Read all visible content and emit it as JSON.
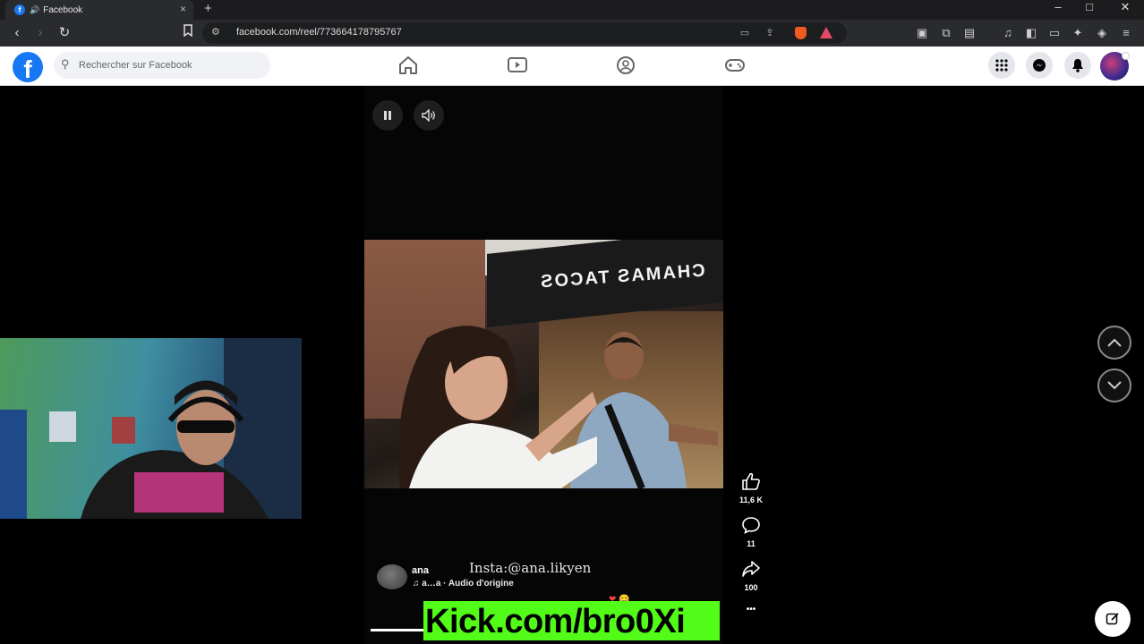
{
  "browser": {
    "tab": {
      "title": "Facebook",
      "close": "×"
    },
    "new_tab": "+",
    "window_controls": {
      "minimize": "–",
      "maximize": "□",
      "close": "✕"
    },
    "url": "facebook.com/reel/773664178795767"
  },
  "facebook": {
    "logo": "f",
    "search": {
      "placeholder": "Rechercher sur Facebook"
    },
    "nav_icons": [
      "home-icon",
      "watch-icon",
      "groups-icon",
      "gaming-icon"
    ],
    "right_icons": [
      "menu-grid-icon",
      "messenger-icon",
      "notifications-icon"
    ]
  },
  "video": {
    "sign_text": "CHAMAS TACOS",
    "overlay_text": "Insta:@ana.likyen"
  },
  "actions": {
    "likes": "11,6 K",
    "comments": "11",
    "shares": "100",
    "more": "•••"
  },
  "caption": {
    "author": "ana",
    "audio": "a…a · Audio d'origine"
  },
  "stream": {
    "banner_text": "Kick.com/bro0Xi",
    "banner_color": "#53fc18"
  },
  "colors": {
    "facebook_blue": "#1877f2",
    "brave_orange": "#f15a22"
  }
}
